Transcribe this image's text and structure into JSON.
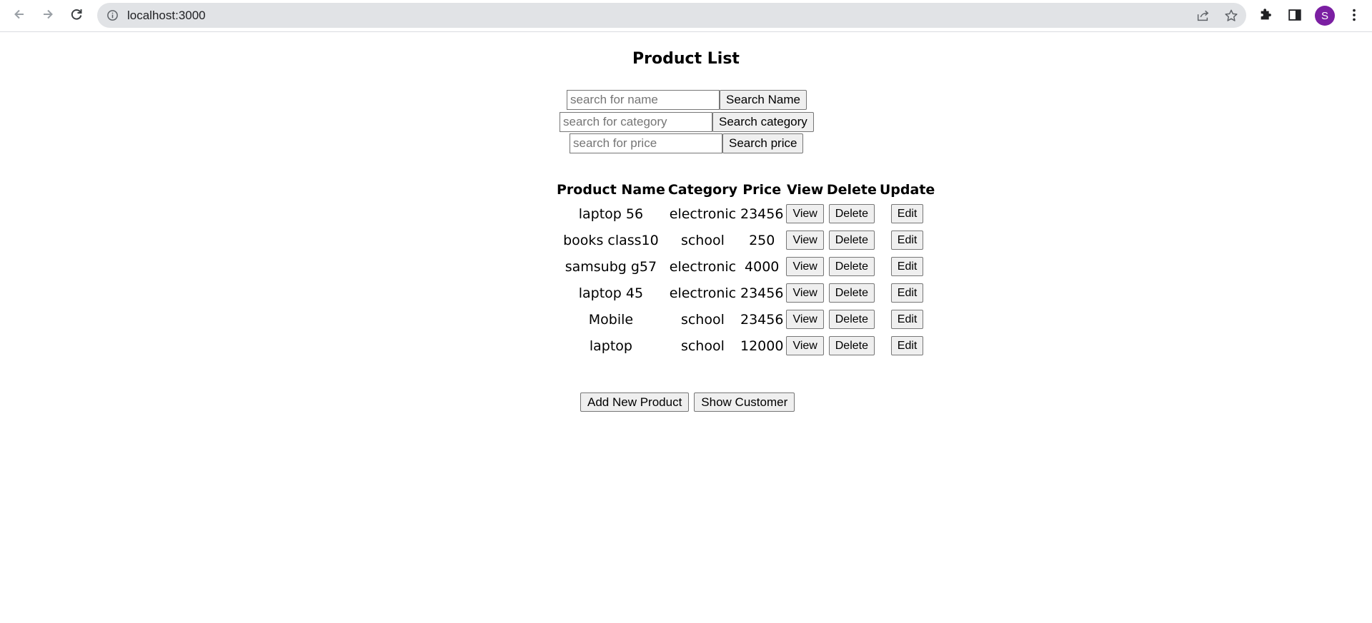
{
  "browser": {
    "url": "localhost:3000",
    "avatar_letter": "S",
    "icons": {
      "back": "arrow-left-icon",
      "forward": "arrow-right-icon",
      "reload": "reload-icon",
      "site_info": "info-icon",
      "share": "share-icon",
      "bookmark": "star-icon",
      "extensions": "puzzle-icon",
      "side_panel": "side-panel-icon",
      "menu": "kebab-menu-icon"
    }
  },
  "page": {
    "title": "Product List",
    "search": {
      "name": {
        "placeholder": "search for name",
        "value": "",
        "button": "Search Name"
      },
      "category": {
        "placeholder": "search for category",
        "value": "",
        "button": "Search category"
      },
      "price": {
        "placeholder": "search for price",
        "value": "",
        "button": "Search price"
      }
    },
    "table": {
      "headers": [
        "Product Name",
        "Category",
        "Price",
        "View",
        "Delete",
        "Update"
      ],
      "rows": [
        {
          "name": "laptop 56",
          "category": "electronic",
          "price": "23456",
          "view": "View",
          "delete": "Delete",
          "edit": "Edit"
        },
        {
          "name": "books class10",
          "category": "school",
          "price": "250",
          "view": "View",
          "delete": "Delete",
          "edit": "Edit"
        },
        {
          "name": "samsubg g57",
          "category": "electronic",
          "price": "4000",
          "view": "View",
          "delete": "Delete",
          "edit": "Edit"
        },
        {
          "name": "laptop 45",
          "category": "electronic",
          "price": "23456",
          "view": "View",
          "delete": "Delete",
          "edit": "Edit"
        },
        {
          "name": "Mobile",
          "category": "school",
          "price": "23456",
          "view": "View",
          "delete": "Delete",
          "edit": "Edit"
        },
        {
          "name": "laptop",
          "category": "school",
          "price": "12000",
          "view": "View",
          "delete": "Delete",
          "edit": "Edit"
        }
      ]
    },
    "actions": {
      "add": "Add New Product",
      "customers": "Show Customer"
    }
  },
  "colors": {
    "avatar": "#7b1fa2",
    "omnibox": "#e1e3e6",
    "button_bg": "#efefef"
  }
}
